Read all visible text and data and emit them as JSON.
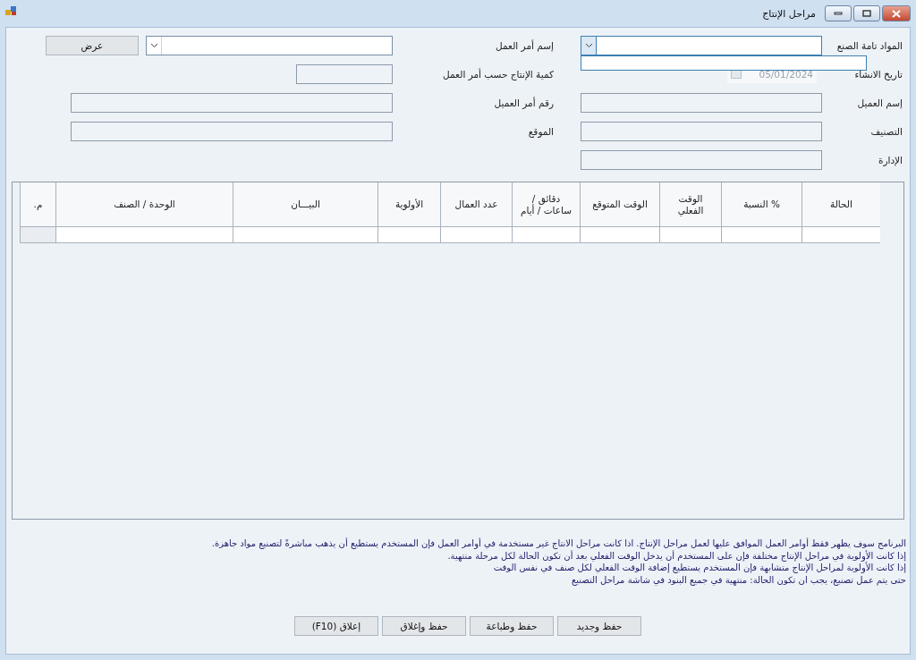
{
  "window": {
    "title": "مراحل الإنتاج"
  },
  "form": {
    "rows": [
      {
        "right": {
          "label": "المواد تامة الصنع",
          "kind": "combo",
          "expanded": true
        },
        "left": {
          "label": "إسم أمر العمل",
          "kind": "combo",
          "expanded": false,
          "button": "عرض"
        }
      },
      {
        "right": {
          "label": "تاريخ الانشاء",
          "kind": "date",
          "value": "05/01/2024"
        },
        "left": {
          "label": "كمية الإنتاج حسب أمر العمل",
          "kind": "short"
        }
      },
      {
        "right": {
          "label": "إسم العميل",
          "kind": "text"
        },
        "left": {
          "label": "رقم أمر العميل",
          "kind": "text"
        }
      },
      {
        "right": {
          "label": "التصنيف",
          "kind": "text"
        },
        "left": {
          "label": "الموقع",
          "kind": "text"
        }
      },
      {
        "right": {
          "label": "الإدارة",
          "kind": "text"
        }
      }
    ]
  },
  "table": {
    "columns": [
      "الحالة",
      "% النسبة",
      "الوقت الفعلي",
      "الوقت المتوقع",
      "دقائق / ساعات / أيام",
      "عدد العمال",
      "الأولوية",
      "البيـــان",
      "الوحدة / الصنف",
      "م."
    ]
  },
  "notes": [
    "البرنامج سوف يظهر فقط أوامر العمل الموافق عليها لعمل مراحل الإنتاج. اذا كانت مراحل الانتاج غير مستخدمة في أوامر العمل فإن المستخدم يستطيع أن يذهب مباشرةً لتصنيع مواد جاهزة.",
    "إذا كانت الأولوية في مراحل الإنتاج مختلفة فإن على المستخدم أن يدخل الوقت الفعلي بعد أن تكون الحالة لكل مرحلة منتهية.",
    "إذا كانت الأولوية لمراحل الإنتاج متشابهة فإن المستخدم يستطيع إضافة الوقت الفعلي لكل صنف في نفس الوقت",
    "حتى يتم عمل تصنيع، يجب ان تكون الحالة: منتهية في جميع البنود في شاشة مراحل التصنيع"
  ],
  "buttons": [
    "حفظ وجديد",
    "حفظ وطباعة",
    "حفظ وإغلاق",
    "إعلاق (F10)"
  ]
}
